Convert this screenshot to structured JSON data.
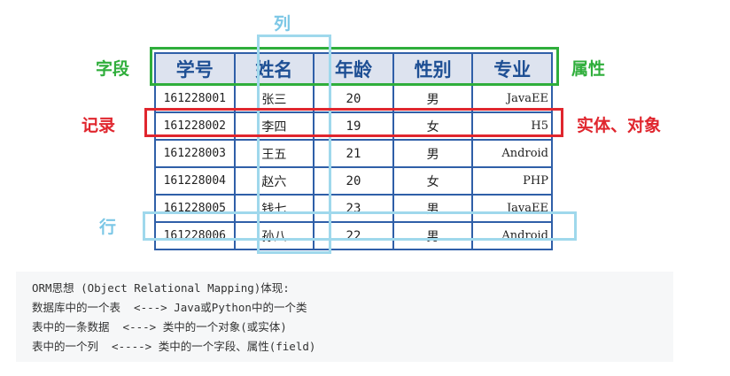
{
  "diagram": {
    "labels": {
      "column": "列",
      "field": "字段",
      "attribute": "属性",
      "record": "记录",
      "entity": "实体、对象",
      "row": "行"
    },
    "colors": {
      "field_box": "#2fae3b",
      "column_box": "#9fd8ec",
      "record_box": "#e0262e",
      "row_box": "#9fd8ec",
      "table_border": "#2f5fa8",
      "header_bg": "#dde3ef"
    }
  },
  "table": {
    "headers": [
      "学号",
      "姓名",
      "年龄",
      "性别",
      "专业"
    ],
    "rows": [
      [
        "161228001",
        "张三",
        "20",
        "男",
        "JavaEE"
      ],
      [
        "161228002",
        "李四",
        "19",
        "女",
        "H5"
      ],
      [
        "161228003",
        "王五",
        "21",
        "男",
        "Android"
      ],
      [
        "161228004",
        "赵六",
        "20",
        "女",
        "PHP"
      ],
      [
        "161228005",
        "钱七",
        "23",
        "男",
        "JavaEE"
      ],
      [
        "161228006",
        "孙八",
        "22",
        "男",
        "Android"
      ]
    ]
  },
  "note": {
    "lines": [
      "ORM思想 (Object Relational Mapping)体现:",
      "数据库中的一个表  <---> Java或Python中的一个类",
      "表中的一条数据  <---> 类中的一个对象(或实体)",
      "表中的一个列  <----> 类中的一个字段、属性(field)"
    ]
  }
}
